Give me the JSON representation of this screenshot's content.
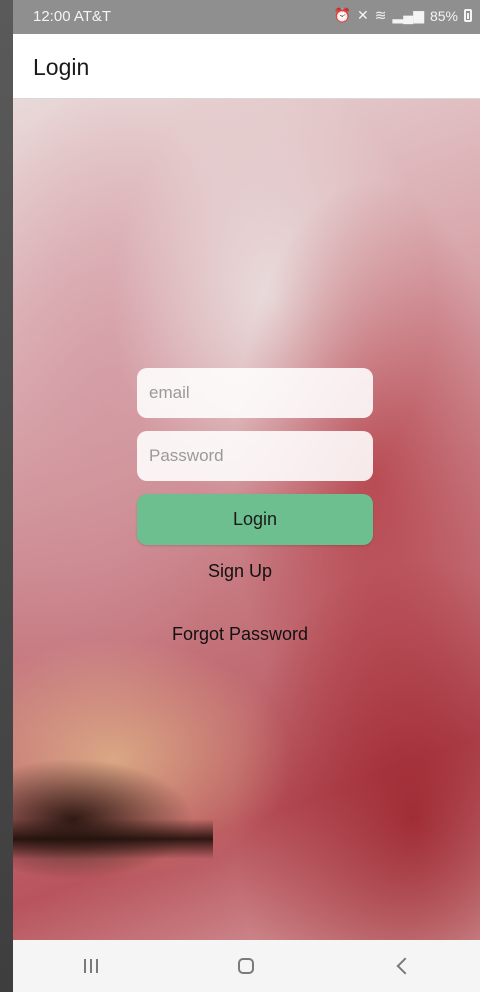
{
  "status_bar": {
    "time_carrier": "12:00 AT&T",
    "battery_percent": "85%",
    "icons": [
      "alarm-icon",
      "mute-icon",
      "wifi-icon",
      "signal-icon",
      "battery-icon"
    ]
  },
  "app_bar": {
    "title": "Login"
  },
  "form": {
    "email_placeholder": "email",
    "password_placeholder": "Password",
    "login_label": "Login",
    "signup_label": "Sign Up",
    "forgot_label": "Forgot Password",
    "login_button_color": "#6dbf8f"
  },
  "nav_bar": {
    "icons": [
      "recents-icon",
      "home-icon",
      "back-icon"
    ]
  }
}
